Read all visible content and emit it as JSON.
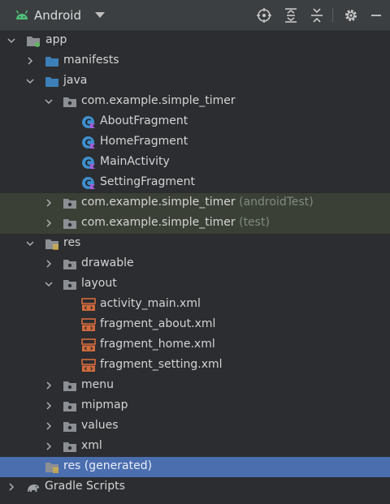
{
  "toolbar": {
    "title": "Android",
    "icons": [
      "android-icon",
      "chevron-down-icon",
      "locate-icon",
      "expand-all-icon",
      "collapse-all-icon",
      "gear-icon",
      "minimize-icon"
    ]
  },
  "tree": {
    "app": "app",
    "manifests": "manifests",
    "java": "java",
    "pkg_main": "com.example.simple_timer",
    "about_fragment": "AboutFragment",
    "home_fragment": "HomeFragment",
    "main_activity": "MainActivity",
    "setting_fragment": "SettingFragment",
    "pkg_android_test": "com.example.simple_timer",
    "pkg_android_test_suffix": "(androidTest)",
    "pkg_test": "com.example.simple_timer",
    "pkg_test_suffix": "(test)",
    "res": "res",
    "drawable": "drawable",
    "layout": "layout",
    "activity_main": "activity_main.xml",
    "fragment_about": "fragment_about.xml",
    "fragment_home": "fragment_home.xml",
    "fragment_setting": "fragment_setting.xml",
    "menu": "menu",
    "mipmap": "mipmap",
    "values": "values",
    "xml": "xml",
    "res_generated": "res (generated)",
    "gradle_scripts": "Gradle Scripts"
  },
  "colors": {
    "panel_bg": "#2b2d30",
    "selected_row": "#4b6eaf",
    "test_row": "#3b4036",
    "folder_blue": "#3d7fb8",
    "class_icon_blue": "#3f8fcf",
    "xml_icon_orange": "#d36a3c"
  }
}
